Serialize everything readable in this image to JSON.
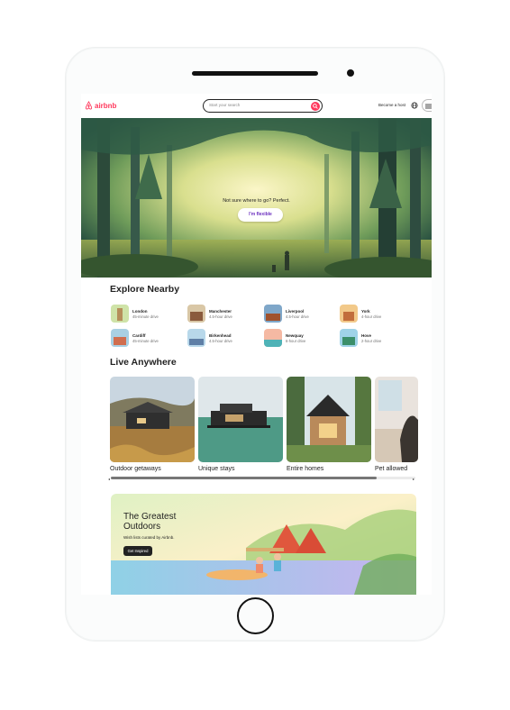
{
  "header": {
    "logo_text": "airbnb",
    "search_placeholder": "Start your search",
    "host_label": "Become a host",
    "brand_color": "#ff385c"
  },
  "hero": {
    "prompt": "Not sure where to go? Perfect.",
    "flexible_button": "I'm flexible"
  },
  "explore": {
    "title": "Explore Nearby",
    "items": [
      {
        "name": "London",
        "drive": "45-minute drive"
      },
      {
        "name": "Manchester",
        "drive": "4.5-hour drive"
      },
      {
        "name": "Liverpool",
        "drive": "4.5-hour drive"
      },
      {
        "name": "York",
        "drive": "4-hour drive"
      },
      {
        "name": "Cardiff",
        "drive": "45-minute drive"
      },
      {
        "name": "Birkenhead",
        "drive": "4.5-hour drive"
      },
      {
        "name": "Newquay",
        "drive": "6-hour drive"
      },
      {
        "name": "Hove",
        "drive": "2-hour drive"
      }
    ]
  },
  "live": {
    "title": "Live Anywhere",
    "cards": [
      {
        "label": "Outdoor getaways"
      },
      {
        "label": "Unique stays"
      },
      {
        "label": "Entire homes"
      },
      {
        "label": "Pet allowed"
      }
    ]
  },
  "banner": {
    "title": "The Greatest Outdoors",
    "subtitle": "Wish lists curated by Airbnb.",
    "button": "Get Inspired"
  }
}
